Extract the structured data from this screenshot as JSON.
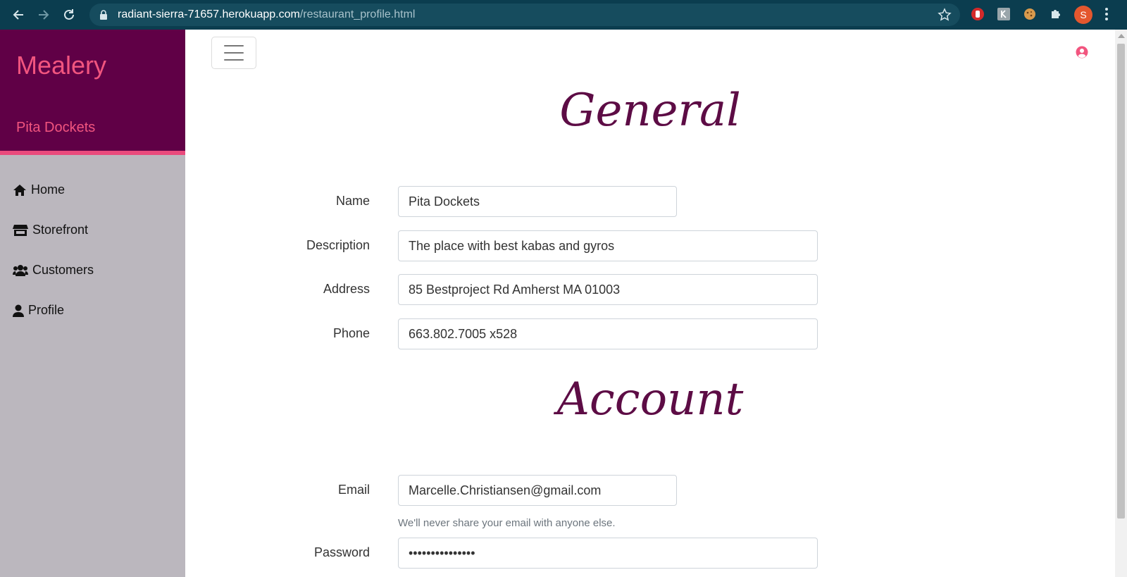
{
  "browser": {
    "url_host": "radiant-sierra-71657.herokuapp.com",
    "url_path": "/restaurant_profile.html",
    "profile_initial": "S"
  },
  "sidebar": {
    "brand": "Mealery",
    "restaurant_name": "Pita Dockets",
    "items": [
      {
        "label": "Home",
        "icon": "home-icon"
      },
      {
        "label": "Storefront",
        "icon": "store-icon"
      },
      {
        "label": "Customers",
        "icon": "users-icon"
      },
      {
        "label": "Profile",
        "icon": "user-icon"
      }
    ]
  },
  "general": {
    "title": "General",
    "name_label": "Name",
    "name_value": "Pita Dockets",
    "description_label": "Description",
    "description_value": "The place with best kabas and gyros",
    "address_label": "Address",
    "address_value": "85 Bestproject Rd Amherst MA 01003",
    "phone_label": "Phone",
    "phone_value": "663.802.7005 x528"
  },
  "account": {
    "title": "Account",
    "email_label": "Email",
    "email_value": "Marcelle.Christiansen@gmail.com",
    "email_help": "We'll never share your email with anyone else.",
    "password_label": "Password",
    "password_value": "•••••••••••••••"
  },
  "colors": {
    "brand_bg": "#600046",
    "accent": "#f2557f",
    "title": "#5d0c45"
  }
}
